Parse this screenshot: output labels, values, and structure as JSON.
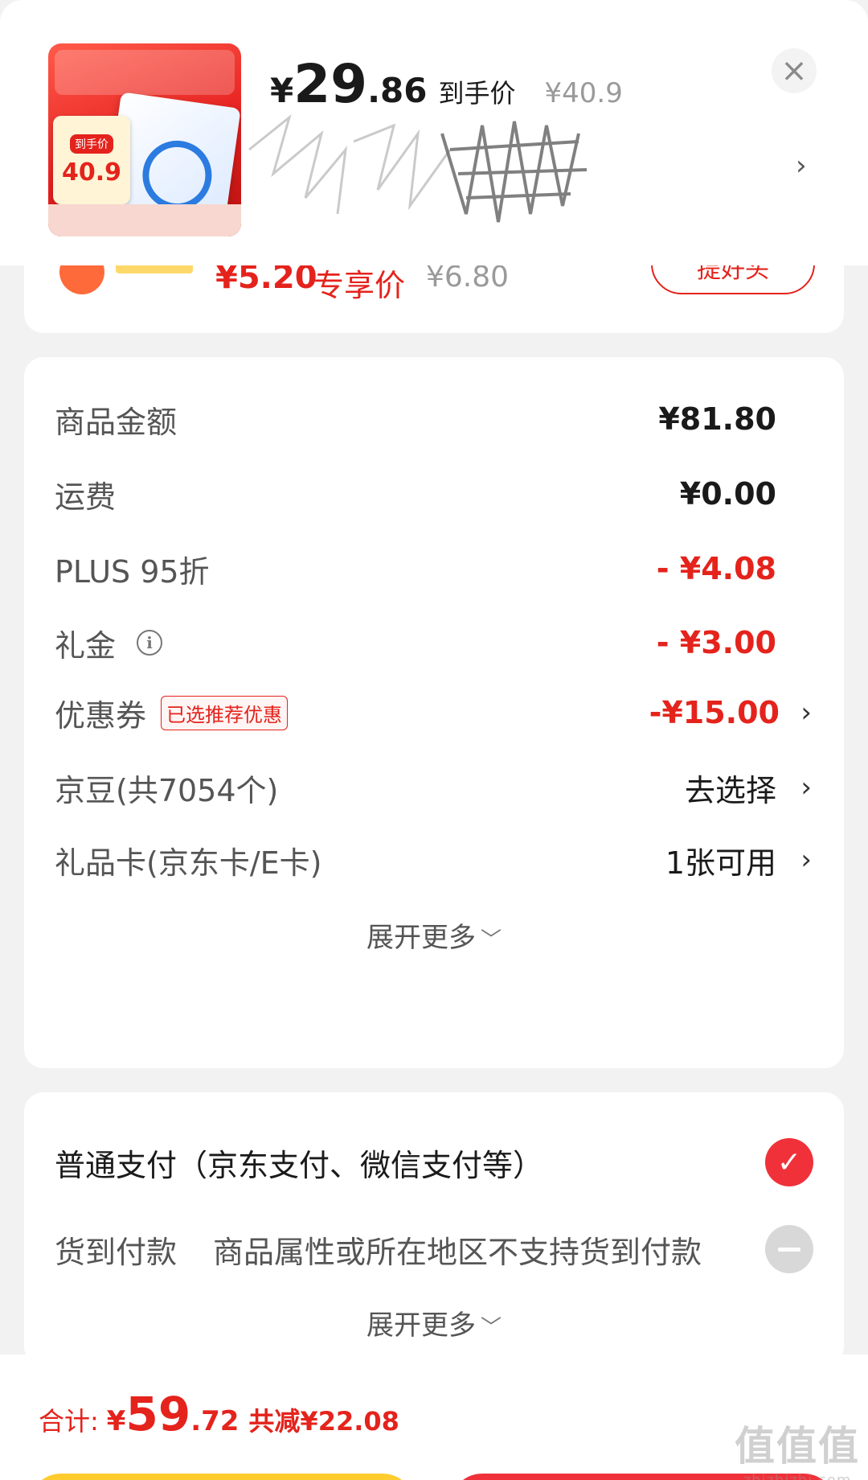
{
  "header": {
    "product_thumb": {
      "price_label": "到手价",
      "price_value": "40.9"
    },
    "price_currency": "¥",
    "price_integer": "29",
    "price_decimal": ".86",
    "price_caption": "到手价",
    "original_price": "¥40.9",
    "close_icon": "close-icon",
    "chevron_icon": "chevron-right-icon"
  },
  "prev_item": {
    "price": "¥5.20",
    "price_label": "专享价",
    "original_price": "¥6.80",
    "button_label": "提好头"
  },
  "amounts": {
    "rows": [
      {
        "label": "商品金额",
        "value": "¥81.80"
      },
      {
        "label": "运费",
        "value": "¥0.00"
      },
      {
        "label": "PLUS 95折",
        "value": "- ¥4.08"
      },
      {
        "label": "礼金",
        "value": "- ¥3.00"
      },
      {
        "label": "优惠券",
        "badge": "已选推荐优惠",
        "value": "-¥15.00"
      },
      {
        "label": "京豆(共7054个)",
        "value": "去选择"
      },
      {
        "label": "礼品卡(京东卡/E卡)",
        "value": "1张可用"
      }
    ],
    "expand_label": "展开更多"
  },
  "payment": {
    "normal": {
      "label": "普通支付（京东支付、微信支付等）"
    },
    "cod": {
      "label": "货到付款",
      "note": "商品属性或所在地区不支持货到付款"
    },
    "expand_label": "展开更多"
  },
  "footer": {
    "total_label": "合计:",
    "total_currency": "¥",
    "total_integer": "59",
    "total_decimal": ".72",
    "saved_label": "共减¥22.08"
  },
  "watermark": {
    "big": "值值值",
    "small": "zhizhizhi.com"
  },
  "colors": {
    "accent_red": "#e4231c",
    "check_red": "#f0313a",
    "button_yellow": "#ffcc2e",
    "background": "#f2f2f2"
  }
}
